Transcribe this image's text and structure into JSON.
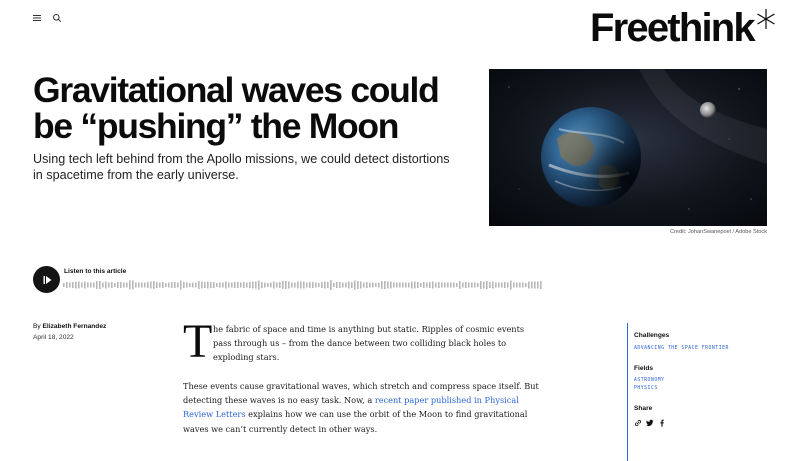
{
  "header": {
    "menu_icon": "hamburger-menu-icon",
    "search_icon": "search-icon",
    "logo_text": "Freethink",
    "logo_mark": "asterisk-star-icon"
  },
  "article": {
    "headline_line1": "Gravitational waves could",
    "headline_line2": "be “pushing” the Moon",
    "subhead": "Using tech left behind from the Apollo missions, we could detect distortions in spacetime from the early universe.",
    "image_credit": "Credit: JohanSwanepoel / Adobe Stock",
    "byline_prefix": "By ",
    "author": "Elizabeth Fernandez",
    "date": "April 18, 2022",
    "dropcap": "T",
    "para1": "he fabric of space and time is anything but static. Ripples of cosmic events pass through us – from the dance between two colliding black holes to exploding stars.",
    "para2_before": "These events cause gravitational waves, which stretch and compress space itself. But detecting these waves is no easy task. Now, a ",
    "para2_link": "recent paper published in Physical Review Letters",
    "para2_after": " explains how we can use the orbit of the Moon to find gravitational waves we can’t currently detect in other ways."
  },
  "audio": {
    "play_icon": "play-icon",
    "label": "Listen to this article"
  },
  "sidebar": {
    "challenges_heading": "Challenges",
    "challenges": [
      "ADVANCING THE SPACE FRONTIER"
    ],
    "fields_heading": "Fields",
    "fields": [
      "ASTRONOMY",
      "PHYSICS"
    ],
    "share_heading": "Share",
    "share_icons": [
      "link-icon",
      "twitter-icon",
      "facebook-icon"
    ]
  },
  "colors": {
    "accent": "#2b66d6",
    "text": "#111111",
    "background": "#ffffff"
  }
}
